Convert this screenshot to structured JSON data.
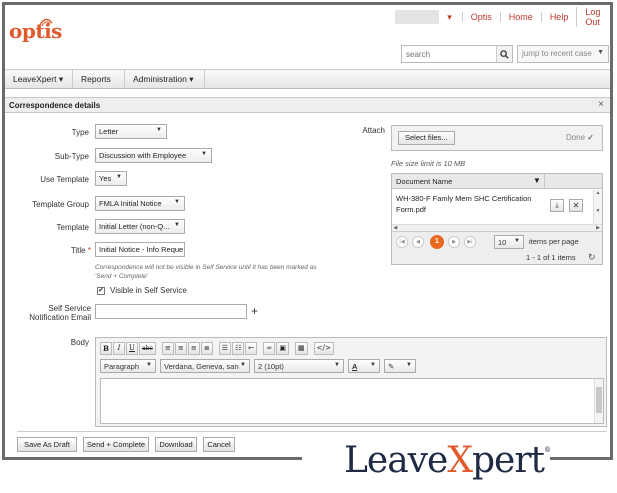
{
  "topnav": {
    "user_menu": "Optis",
    "home": "Home",
    "help": "Help",
    "logout": "Log Out"
  },
  "logo": {
    "text": "optis"
  },
  "search": {
    "placeholder": "search",
    "recent_placeholder": "jump to recent case"
  },
  "mainnav": {
    "items": [
      "LeaveXpert",
      "Reports",
      "Administration"
    ]
  },
  "dialog": {
    "title": "Correspondence details",
    "fields": {
      "type": {
        "label": "Type",
        "value": "Letter"
      },
      "subtype": {
        "label": "Sub-Type",
        "value": "Discussion with Employee"
      },
      "use_template": {
        "label": "Use Template",
        "value": "Yes"
      },
      "template_group": {
        "label": "Template Group",
        "value": "FMLA Initial Notice"
      },
      "template": {
        "label": "Template",
        "value": "Initial Letter (non-Q..."
      },
      "title": {
        "label": "Title",
        "required": "*",
        "value": "Initial Notice - Info Reque"
      },
      "note_line1": "Correspondence will not be visible in Self Service until it has been marked as",
      "note_line2": "'Send + Complete'",
      "visible_checkbox": {
        "label": "Visible in Self Service",
        "checked": true
      },
      "notification_email": {
        "label_line1": "Self Service",
        "label_line2": "Notification Email",
        "value": ""
      },
      "body": {
        "label": "Body"
      }
    },
    "attach": {
      "label": "Attach",
      "select_files": "Select files...",
      "done": "Done",
      "limit": "File size limit is 10 MB",
      "grid": {
        "column": "Document Name",
        "rows": [
          {
            "name_line1": "WH-380-F Famly Mem SHC Certification",
            "name_line2": "Form.pdf"
          }
        ],
        "current_page": "1",
        "page_size": "10",
        "items_per_page": "items per page",
        "count": "1 - 1 of 1 items"
      }
    },
    "editor": {
      "format": "Paragraph",
      "font": "Verdana, Geneva, san",
      "size": "2 (10pt)",
      "buttons": {
        "bold": "B",
        "italic": "I",
        "underline": "U",
        "strike": "abc",
        "source": "</>"
      }
    },
    "footer": {
      "save_draft": "Save As Draft",
      "send_complete": "Send + Complete",
      "download": "Download",
      "cancel": "Cancel"
    }
  },
  "brand": {
    "leave": "Leave",
    "x": "X",
    "pert": "pert",
    "reg": "®"
  },
  "colors": {
    "accent": "#e05a2b",
    "link": "#c0392b",
    "brand_navy": "#1f2a44"
  }
}
